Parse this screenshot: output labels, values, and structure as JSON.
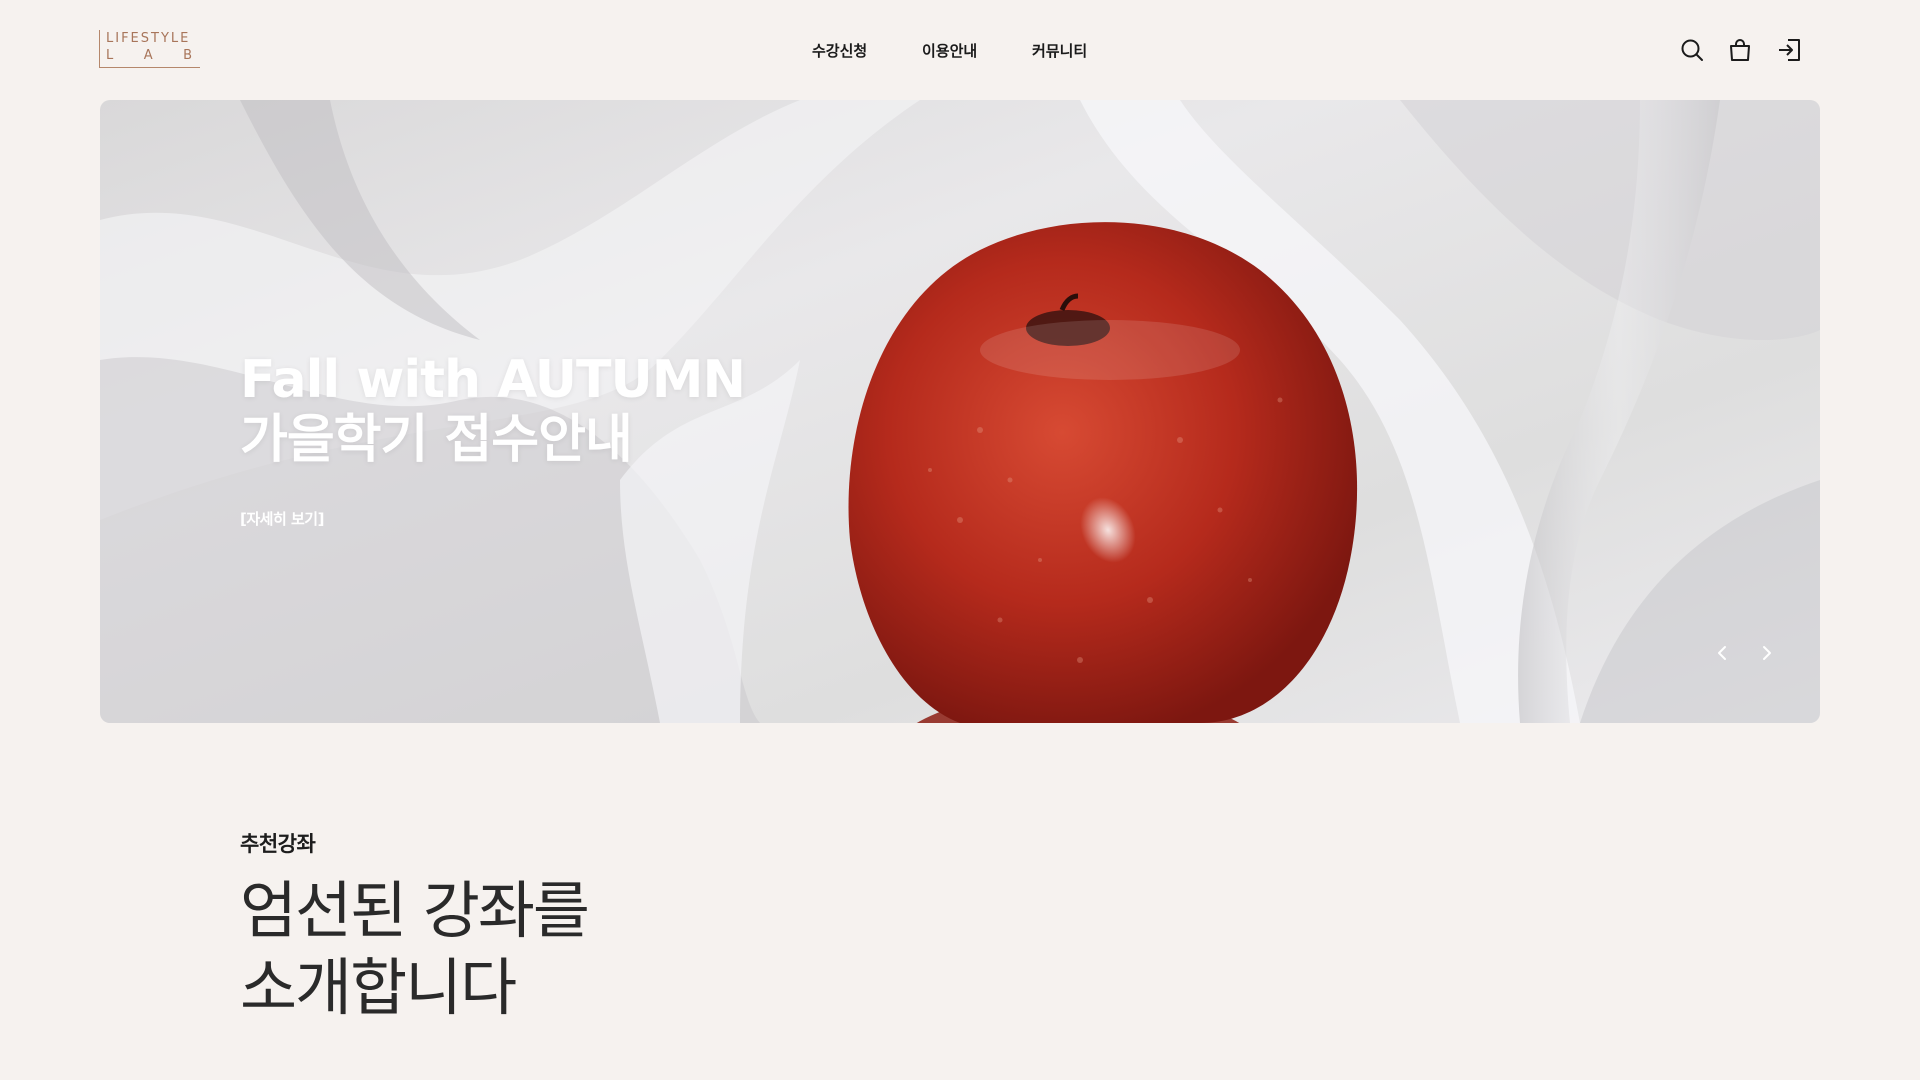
{
  "header": {
    "logo": {
      "line1": "LIFESTYLE",
      "line2": [
        "L",
        "A",
        "B"
      ]
    },
    "nav": [
      {
        "label": "수강신청"
      },
      {
        "label": "이용안내"
      },
      {
        "label": "커뮤니티"
      }
    ],
    "icons": [
      "search-icon",
      "shopping-bag-icon",
      "login-icon"
    ]
  },
  "hero": {
    "title_line1": "Fall with AUTUMN",
    "title_line2": "가을학기 접수안내",
    "link_label": "[자세히 보기]",
    "prev_icon": "chevron-left-icon",
    "next_icon": "chevron-right-icon"
  },
  "section": {
    "label": "추천강좌",
    "heading_line1": "엄선된 강좌를",
    "heading_line2": "소개합니다"
  },
  "colors": {
    "background": "#f6f2ef",
    "logo": "#a8755a",
    "text": "#1d1d1d",
    "hero_text": "#ffffff"
  }
}
